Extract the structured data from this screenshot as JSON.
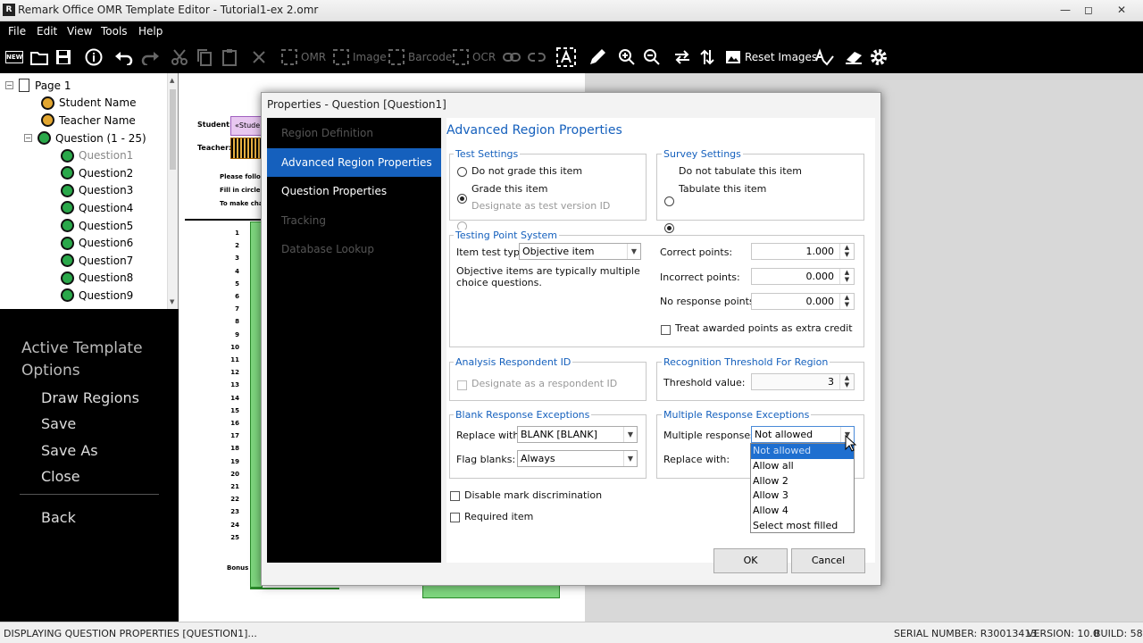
{
  "window": {
    "title": "Remark Office OMR Template Editor - Tutorial1-ex 2.omr",
    "app_icon": "R"
  },
  "menu": [
    "File",
    "Edit",
    "View",
    "Tools",
    "Help"
  ],
  "toolbar": {
    "omr": "OMR",
    "image": "Image",
    "barcode": "Barcode",
    "ocr": "OCR",
    "reset_images": "Reset Images",
    "new_badge": "NEW"
  },
  "tree": {
    "page": "Page 1",
    "items": [
      "Student Name",
      "Teacher Name",
      "Question (1 - 25)"
    ],
    "questions": [
      "Question1",
      "Question2",
      "Question3",
      "Question4",
      "Question5",
      "Question6",
      "Question7",
      "Question8",
      "Question9"
    ]
  },
  "left_panel": {
    "heading": "Active Template Options",
    "items": [
      "Draw Regions",
      "Save",
      "Save As",
      "Close"
    ],
    "back": "Back"
  },
  "canvas": {
    "student_label": "Student:",
    "student_field": "«Stude",
    "teacher_label": "Teacher:",
    "instructions": [
      "Please follo",
      "Fill in circle",
      "To make cha"
    ],
    "row_numbers": [
      "1",
      "2",
      "3",
      "4",
      "5",
      "6",
      "7",
      "8",
      "9",
      "10",
      "11",
      "12",
      "13",
      "14",
      "15",
      "16",
      "17",
      "18",
      "19",
      "20",
      "21",
      "22",
      "23",
      "24",
      "25"
    ],
    "bonus": "Bonus"
  },
  "dialog": {
    "title": "Properties - Question [Question1]",
    "nav": [
      {
        "label": "Region Definition",
        "state": "disabled"
      },
      {
        "label": "Advanced Region Properties",
        "state": "active"
      },
      {
        "label": "Question Properties",
        "state": "enabled"
      },
      {
        "label": "Tracking",
        "state": "disabled"
      },
      {
        "label": "Database Lookup",
        "state": "disabled"
      }
    ],
    "heading": "Advanced Region Properties",
    "test_settings": {
      "label": "Test Settings",
      "options": [
        "Do not grade this item",
        "Grade this item",
        "Designate as test version ID"
      ],
      "selected": 1
    },
    "survey_settings": {
      "label": "Survey Settings",
      "options": [
        "Do not tabulate this item",
        "Tabulate this item"
      ],
      "selected": 1
    },
    "testing_point": {
      "label": "Testing Point System",
      "item_type_label": "Item test type:",
      "item_type_value": "Objective item",
      "description": "Objective items are typically multiple choice questions.",
      "correct_label": "Correct points:",
      "correct_value": "1.000",
      "incorrect_label": "Incorrect points:",
      "incorrect_value": "0.000",
      "noresp_label": "No response points:",
      "noresp_value": "0.000",
      "extra_credit": "Treat awarded points as extra credit"
    },
    "analysis": {
      "label": "Analysis Respondent ID",
      "checkbox": "Designate as a respondent ID"
    },
    "recognition": {
      "label": "Recognition Threshold For Region",
      "threshold_label": "Threshold value:",
      "threshold_value": "3"
    },
    "blank": {
      "label": "Blank Response Exceptions",
      "replace_label": "Replace with:",
      "replace_value": "BLANK [BLANK]",
      "flag_label": "Flag blanks:",
      "flag_value": "Always"
    },
    "multiple": {
      "label": "Multiple Response Exceptions",
      "responses_label": "Multiple responses:",
      "responses_value": "Not allowed",
      "replace_label": "Replace with:"
    },
    "disable_mark": "Disable mark discrimination",
    "required": "Required item",
    "ok": "OK",
    "cancel": "Cancel",
    "dropdown_options": [
      "Not allowed",
      "Allow all",
      "Allow 2",
      "Allow 3",
      "Allow 4",
      "Select most filled"
    ]
  },
  "status": {
    "message": "DISPLAYING QUESTION PROPERTIES [QUESTION1]...",
    "serial": "SERIAL NUMBER: R30013413",
    "version": "VERSION: 10.0",
    "build": "BUILD: 58"
  },
  "colors": {
    "accent": "#1560bd",
    "dark": "#000000",
    "green_region": "#7ed67e"
  }
}
